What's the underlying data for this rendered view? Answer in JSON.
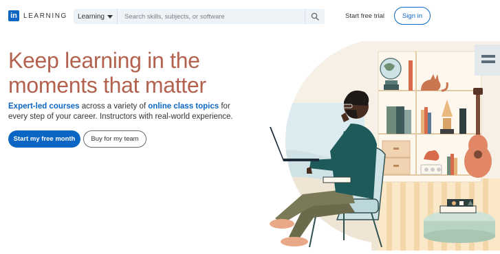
{
  "brand": {
    "logo_mark": "in",
    "wordmark": "LEARNING",
    "accent": "#0a66c2",
    "headline_color": "#b2624e"
  },
  "header": {
    "search": {
      "scope_label": "Learning",
      "placeholder": "Search skills, subjects, or software",
      "icon": "search-icon"
    },
    "trial_link": "Start free trial",
    "signin_label": "Sign in"
  },
  "hero": {
    "title_line1": "Keep learning in the",
    "title_line2": "moments that matter",
    "desc_link1": "Expert-led courses",
    "desc_text1": " across a variety of ",
    "desc_link2": "online class topics",
    "desc_text2": " for every step of your career. Instructors with real-world experience.",
    "primary_cta": "Start my free month",
    "secondary_cta": "Buy for my team"
  },
  "illustration": {
    "icons": [
      "person-with-laptop",
      "armchair",
      "bookshelf",
      "globe",
      "cat",
      "guitar",
      "plant",
      "lamp"
    ]
  }
}
